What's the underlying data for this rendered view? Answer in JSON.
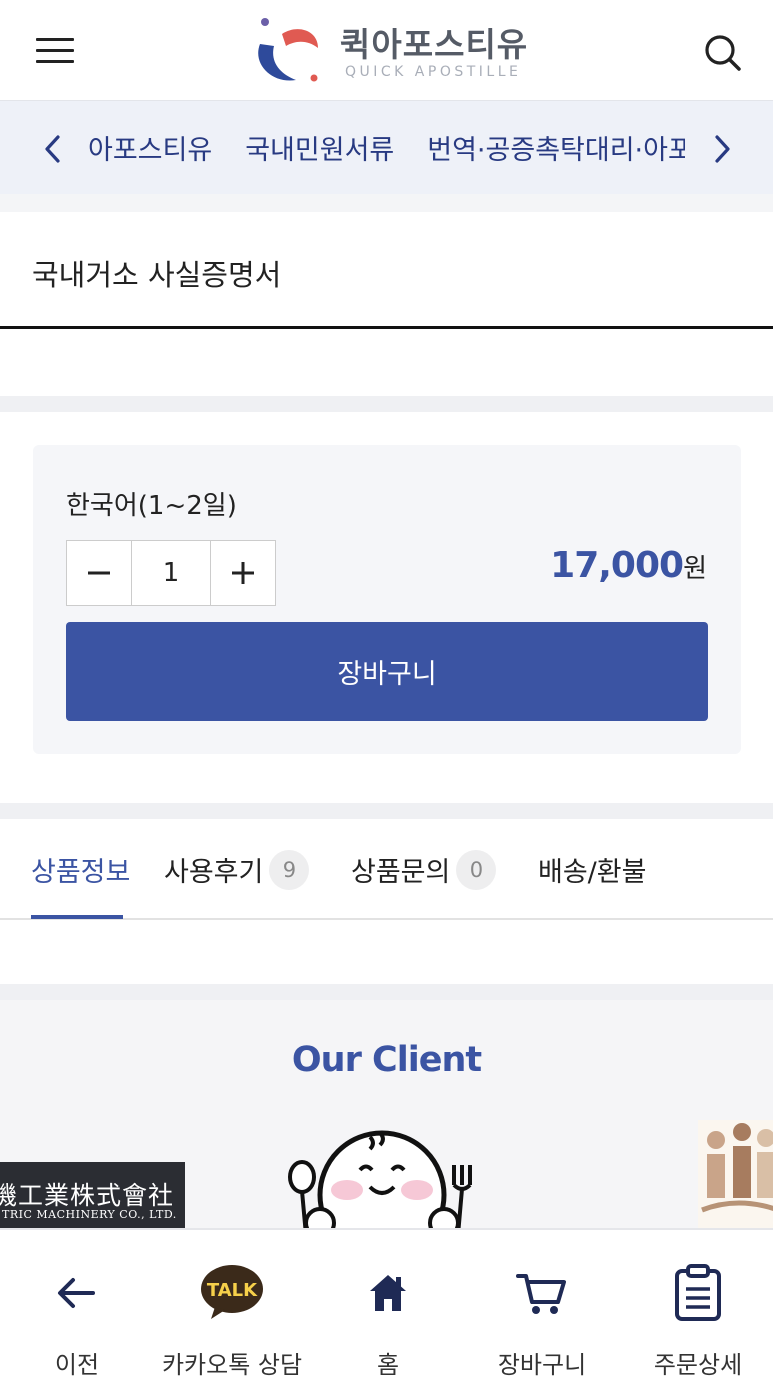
{
  "header": {
    "logo_kr": "퀵아포스티유",
    "logo_en": "QUICK APOSTILLE"
  },
  "categories": {
    "items": [
      "아포스티유",
      "국내민원서류",
      "번역·공증촉탁대리·아포스티유"
    ]
  },
  "product": {
    "title": "국내거소 사실증명서"
  },
  "option": {
    "label": "한국어(1~2일)",
    "quantity": "1",
    "price": "17,000",
    "price_unit": "원",
    "cart_label": "장바구니"
  },
  "tabs": {
    "info": "상품정보",
    "reviews": "사용후기",
    "reviews_count": "9",
    "qna": "상품문의",
    "qna_count": "0",
    "delivery": "배송/환불"
  },
  "clients": {
    "title": "Our Client",
    "banner_kr": "機工業株式會社",
    "banner_en": "TRIC MACHINERY CO., LTD."
  },
  "bottom_nav": {
    "back": "이전",
    "kakao": "카카오톡 상담",
    "kakao_badge": "TALK",
    "home": "홈",
    "cart": "장바구니",
    "orders": "주문상세"
  },
  "colors": {
    "accent": "#3b54a3",
    "nav_text": "#283a82",
    "nav_bg": "#eef1f8"
  }
}
